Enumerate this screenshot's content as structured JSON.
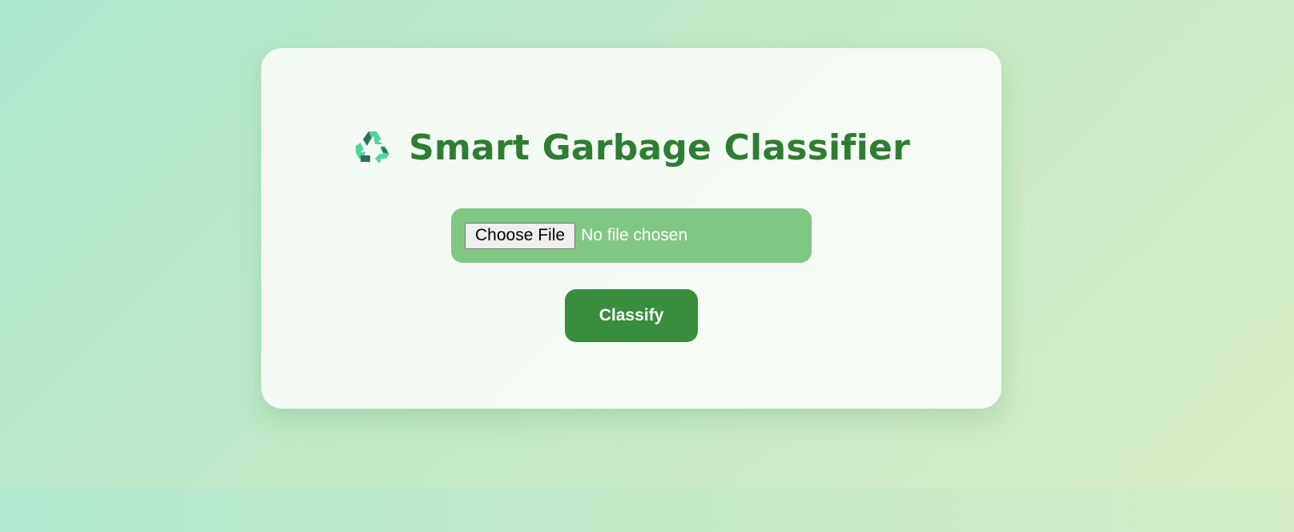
{
  "header": {
    "icon": "recycle-icon",
    "title": "Smart Garbage Classifier"
  },
  "upload": {
    "choose_button_label": "Choose File",
    "status_text": "No file chosen"
  },
  "actions": {
    "classify_label": "Classify"
  },
  "colors": {
    "title": "#2e7d32",
    "upload_box": "#81c784",
    "classify_button": "#388e3c",
    "recycle_light": "#57d49a",
    "recycle_dark": "#2e6f62"
  }
}
